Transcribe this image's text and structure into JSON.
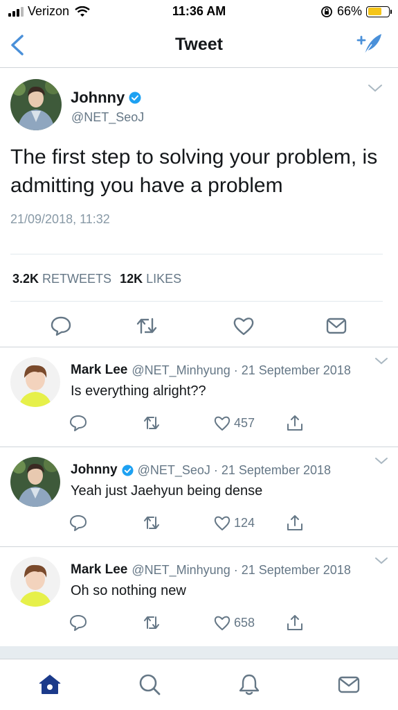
{
  "status_bar": {
    "carrier": "Verizon",
    "time": "11:36 AM",
    "battery_percent": "66%",
    "battery_level": 0.66,
    "icons": [
      "signal-icon",
      "wifi-icon",
      "orientation-lock-icon",
      "battery-icon"
    ]
  },
  "nav": {
    "title": "Tweet",
    "icons": [
      "back-chevron-icon",
      "compose-icon"
    ]
  },
  "main_tweet": {
    "name": "Johnny",
    "handle": "@NET_SeoJ",
    "text": "The first step to solving your problem, is admitting you have a problem",
    "timestamp": "21/09/2018, 11:32",
    "retweets_count": "3.2K",
    "retweets_label": "RETWEETS",
    "likes_count": "12K",
    "likes_label": "LIKES",
    "actions": [
      "reply-icon",
      "retweet-icon",
      "like-icon",
      "message-icon"
    ]
  },
  "replies": [
    {
      "name": "Mark Lee",
      "handle": "@NET_Minhyung",
      "date": "21 September 2018",
      "text": "Is everything alright??",
      "likes": "457",
      "verified": false
    },
    {
      "name": "Johnny",
      "handle": "@NET_SeoJ",
      "date": "21 September 2018",
      "text": "Yeah just Jaehyun being dense",
      "likes": "124",
      "verified": true
    },
    {
      "name": "Mark Lee",
      "handle": "@NET_Minhyung",
      "date": "21 September 2018",
      "text": "Oh so nothing new",
      "likes": "658",
      "verified": false
    }
  ],
  "tab_bar": {
    "tabs": [
      "home-icon",
      "search-icon",
      "notifications-icon",
      "messages-icon"
    ]
  },
  "colors": {
    "accent": "#1da1f2",
    "nav_accent": "#4a90d9",
    "text_secondary": "#657786",
    "icon_gray": "#657786",
    "active_tab": "#1b3a8a",
    "battery": "#f5c518"
  }
}
